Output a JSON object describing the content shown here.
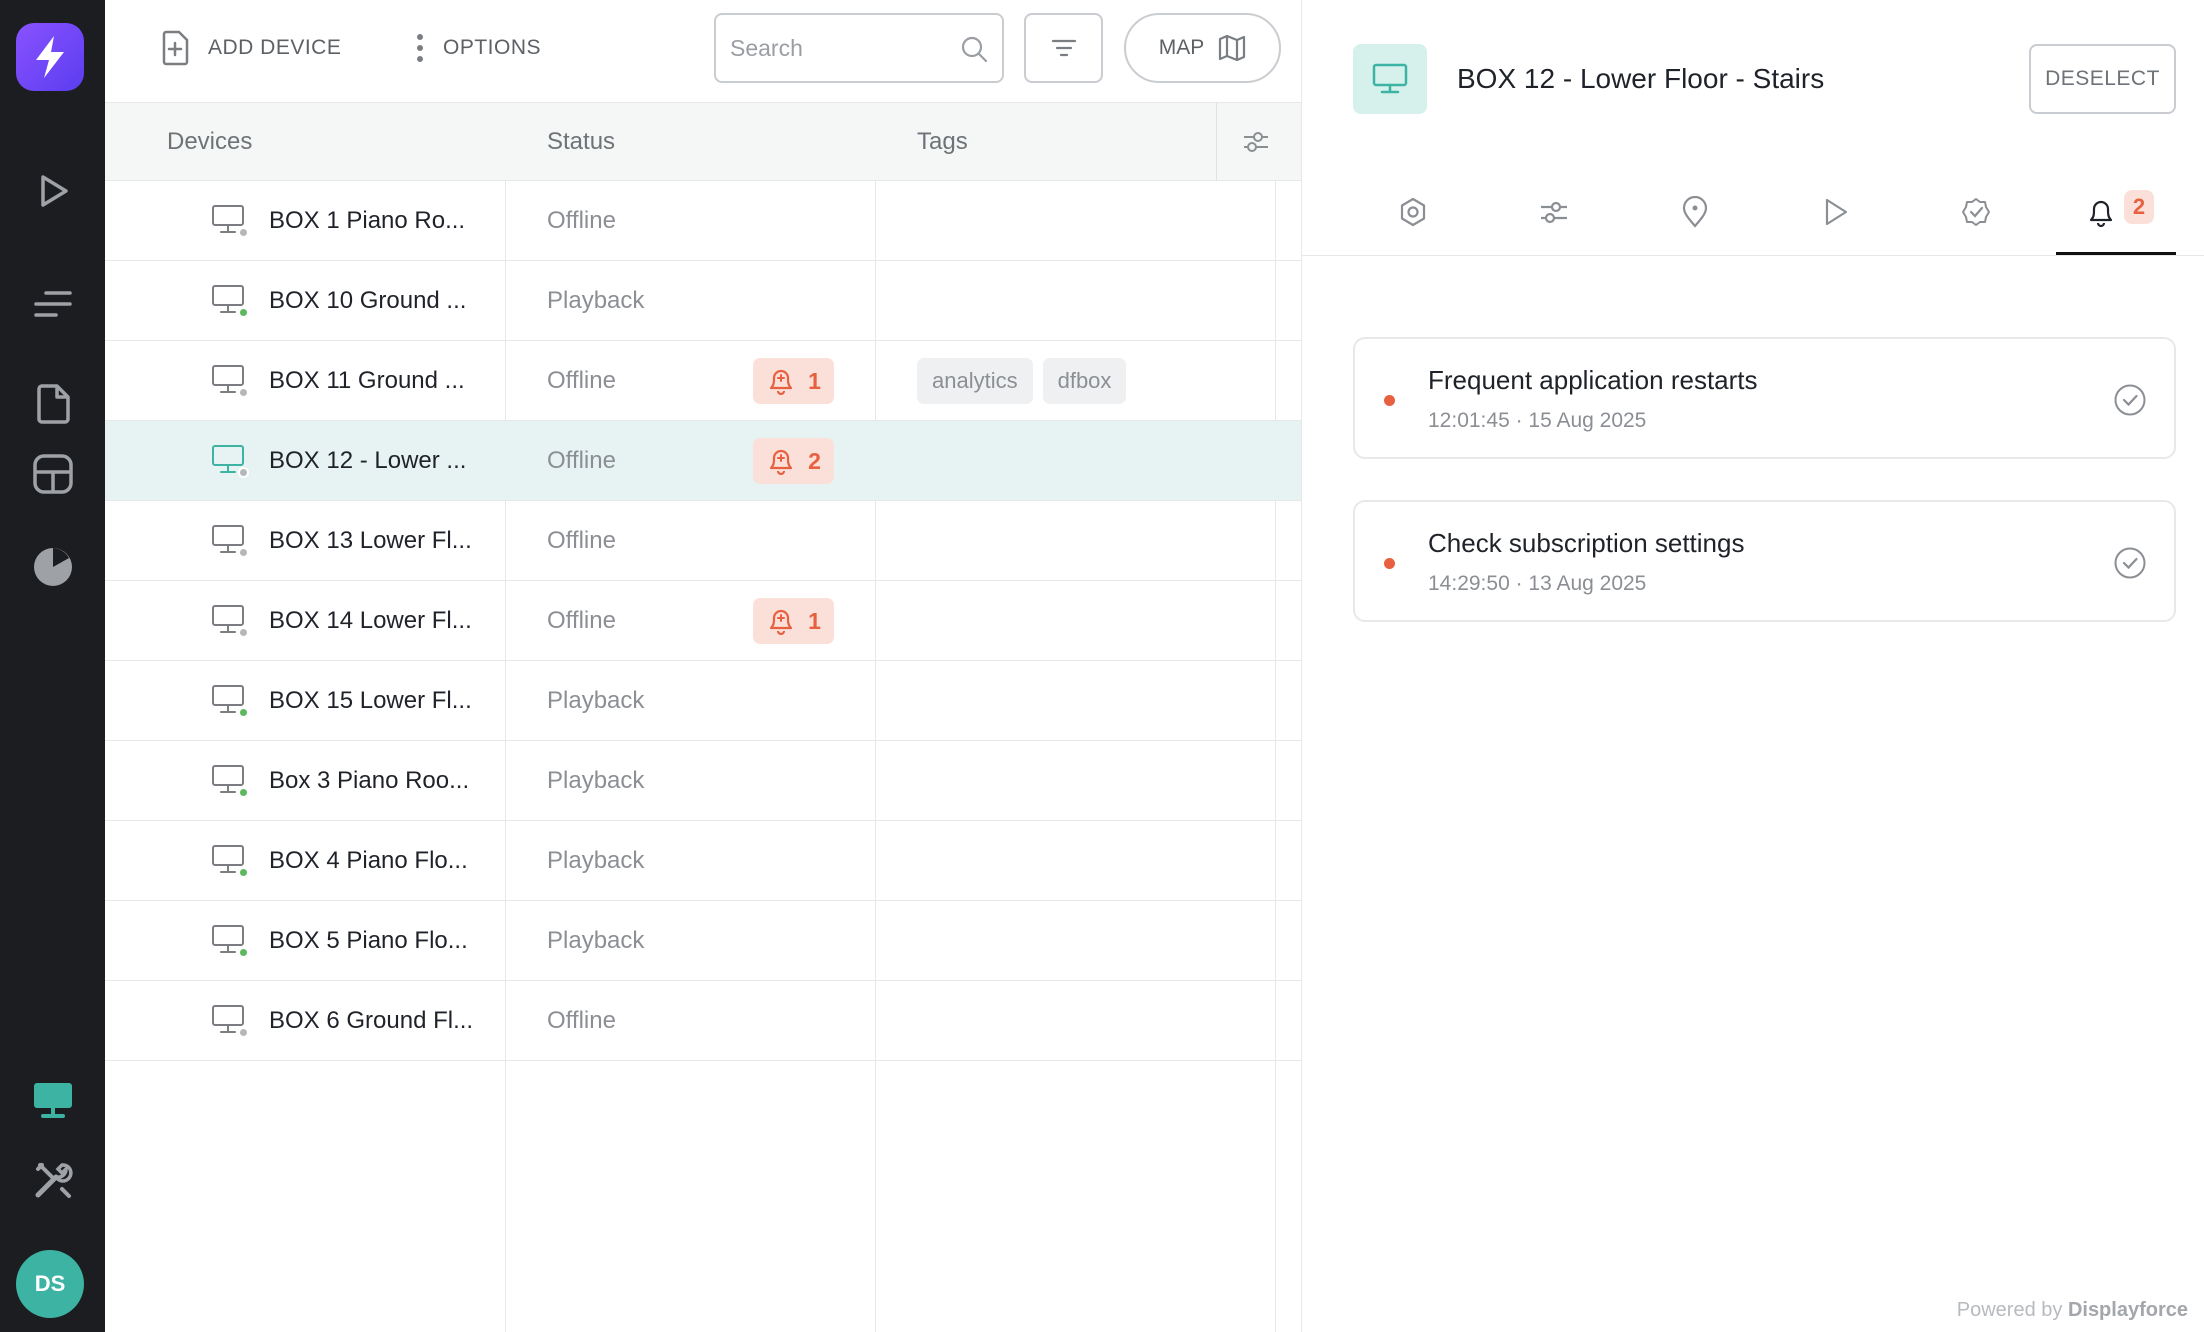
{
  "sidebar": {
    "logo_icon": "bolt-icon",
    "items": [
      {
        "name": "play-icon"
      },
      {
        "name": "playlist-icon"
      },
      {
        "name": "document-icon"
      },
      {
        "name": "layout-icon"
      },
      {
        "name": "analytics-pie-icon"
      },
      {
        "name": "monitor-icon",
        "active": true
      },
      {
        "name": "tools-icon"
      }
    ],
    "avatar_initials": "DS"
  },
  "toolbar": {
    "add_device_label": "ADD DEVICE",
    "options_label": "OPTIONS",
    "search_placeholder": "Search",
    "map_label": "MAP"
  },
  "table": {
    "headers": {
      "devices": "Devices",
      "status": "Status",
      "tags": "Tags"
    },
    "rows": [
      {
        "name": "BOX 1 Piano Ro...",
        "status": "Offline",
        "online": false,
        "alerts": "",
        "tags": []
      },
      {
        "name": "BOX 10 Ground ...",
        "status": "Playback",
        "online": true,
        "alerts": "",
        "tags": []
      },
      {
        "name": "BOX 11 Ground ...",
        "status": "Offline",
        "online": false,
        "alerts": "1",
        "tags": [
          "analytics",
          "dfbox"
        ]
      },
      {
        "name": "BOX 12 - Lower ...",
        "status": "Offline",
        "online": false,
        "alerts": "2",
        "tags": [],
        "selected": true
      },
      {
        "name": "BOX 13 Lower Fl...",
        "status": "Offline",
        "online": false,
        "alerts": "",
        "tags": []
      },
      {
        "name": "BOX 14 Lower Fl...",
        "status": "Offline",
        "online": false,
        "alerts": "1",
        "tags": []
      },
      {
        "name": "BOX 15 Lower Fl...",
        "status": "Playback",
        "online": true,
        "alerts": "",
        "tags": []
      },
      {
        "name": "Box 3 Piano Roo...",
        "status": "Playback",
        "online": true,
        "alerts": "",
        "tags": []
      },
      {
        "name": "BOX 4 Piano Flo...",
        "status": "Playback",
        "online": true,
        "alerts": "",
        "tags": []
      },
      {
        "name": "BOX 5 Piano Flo...",
        "status": "Playback",
        "online": true,
        "alerts": "",
        "tags": []
      },
      {
        "name": "BOX 6 Ground Fl...",
        "status": "Offline",
        "online": false,
        "alerts": "",
        "tags": []
      }
    ]
  },
  "detail": {
    "title": "BOX 12 - Lower Floor - Stairs",
    "deselect_label": "DESELECT",
    "tabs": [
      {
        "name": "settings-gear-icon"
      },
      {
        "name": "sliders-icon"
      },
      {
        "name": "location-pin-icon"
      },
      {
        "name": "play-icon"
      },
      {
        "name": "verified-check-icon"
      },
      {
        "name": "bell-icon",
        "badge": "2",
        "active": true
      }
    ],
    "alerts": [
      {
        "title": "Frequent application restarts",
        "time": "12:01:45 · 15 Aug 2025"
      },
      {
        "title": "Check subscription settings",
        "time": "14:29:50 · 13 Aug 2025"
      }
    ],
    "powered_by": "Powered by",
    "brand": "Displayforce"
  },
  "colors": {
    "rail_bg": "#1c1d20",
    "accent_teal": "#3db3a3",
    "alert_red": "#e8603f",
    "alert_bg": "#fbe0da",
    "online_green": "#5cb85c",
    "offline_gray": "#b5b8bb",
    "selected_row": "#e6f3f2"
  }
}
